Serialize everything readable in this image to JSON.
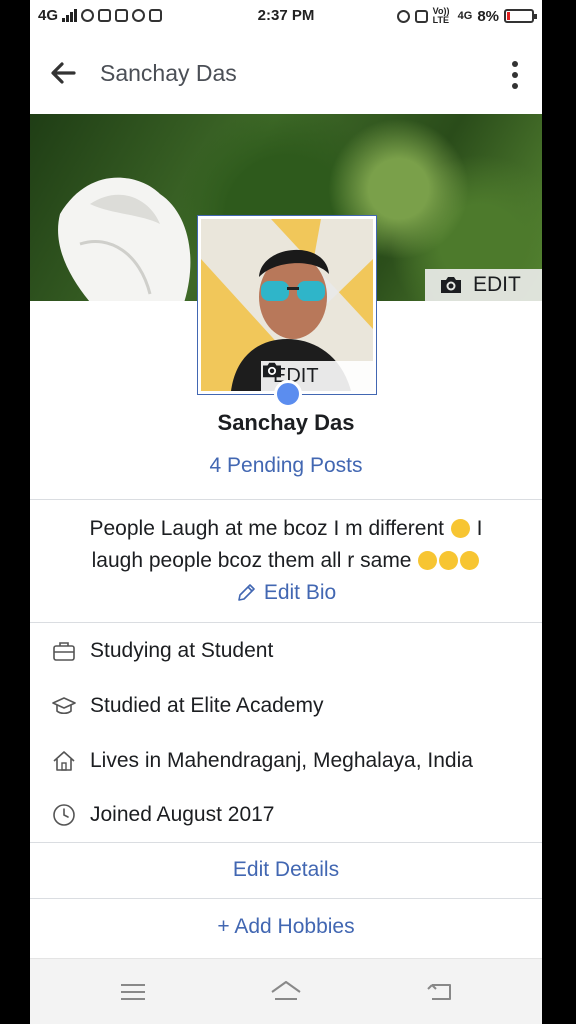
{
  "status_bar": {
    "network": "4G",
    "time": "2:37 PM",
    "volte": "Vo)) LTE",
    "net2": "4G",
    "battery": "8%"
  },
  "header": {
    "title": "Sanchay Das",
    "back_icon": "arrow-left-icon",
    "more_icon": "more-vertical-icon"
  },
  "cover": {
    "edit_label": "EDIT",
    "edit_icon": "camera-icon"
  },
  "profile": {
    "edit_label": "EDIT",
    "name": "Sanchay Das",
    "pending_posts": "4 Pending Posts"
  },
  "bio": {
    "line1": "People Laugh at me bcoz I m different",
    "line2": "laugh people bcoz them all r same",
    "line1_tail": "I",
    "edit_label": "Edit Bio"
  },
  "details": [
    {
      "icon": "briefcase-icon",
      "text": "Studying at Student"
    },
    {
      "icon": "graduation-cap-icon",
      "text": "Studied at Elite Academy"
    },
    {
      "icon": "home-icon",
      "text": "Lives in Mahendraganj, Meghalaya, India"
    },
    {
      "icon": "clock-icon",
      "text": "Joined August 2017"
    }
  ],
  "actions": {
    "edit_details": "Edit Details",
    "add_hobbies": "+ Add Hobbies"
  },
  "colors": {
    "link": "#4267b2",
    "text": "#1c1e21",
    "secondary": "#4b4f56"
  }
}
